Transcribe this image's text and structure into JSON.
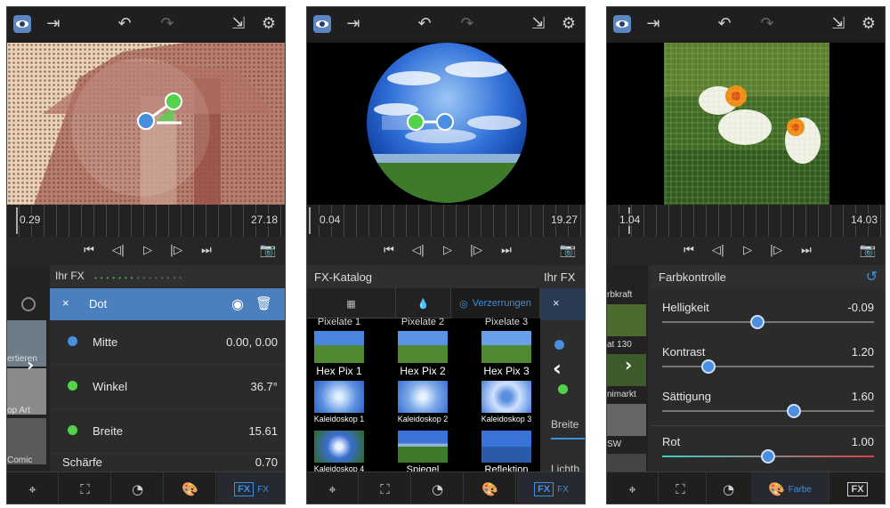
{
  "screens": [
    {
      "timeline": {
        "start": "0.29",
        "end": "27.18"
      },
      "panel_title": "Ihr FX",
      "side_labels": [
        "ertieren",
        "op Art",
        "Comic"
      ],
      "selected": {
        "close": "×",
        "name": "Dot"
      },
      "params": [
        {
          "name": "Mitte",
          "value": "0.00, 0.00"
        },
        {
          "name": "Winkel",
          "value": "36.7°"
        },
        {
          "name": "Breite",
          "value": "15.61"
        },
        {
          "name": "Schärfe",
          "value": "0.70"
        }
      ],
      "bottom_active_label": "FX"
    },
    {
      "timeline": {
        "start": "0.04",
        "end": "19.27"
      },
      "panel_title": "FX-Katalog",
      "overlay_title": "Ihr FX",
      "tab_active_label": "Verzerrungen",
      "grid_top": [
        "Pixelate 1",
        "Pixelate 2",
        "Pixelate 3"
      ],
      "grid": [
        [
          "Hex Pix 1",
          "Hex Pix 2",
          "Hex Pix 3"
        ],
        [
          "Kaleidoskop 1",
          "Kaleidoskop 2",
          "Kaleidoskop 3"
        ],
        [
          "Kaleidoskop 4",
          "Spiegel",
          "Reflektion"
        ]
      ],
      "overlay_labels": [
        "Breite",
        "Lichtb"
      ],
      "bottom_active_label": "FX"
    },
    {
      "timeline": {
        "start": "1.04",
        "end": "14.03"
      },
      "panel_title": "Farbkontrolle",
      "side_labels": [
        "rbkraft",
        "at 130",
        "nimarkt",
        "SW"
      ],
      "sliders": [
        {
          "name": "Helligkeit",
          "value": "-0.09",
          "level": 0.45
        },
        {
          "name": "Kontrast",
          "value": "1.20",
          "level": 0.22
        },
        {
          "name": "Sättigung",
          "value": "1.60",
          "level": 0.62
        },
        {
          "name": "Rot",
          "value": "1.00",
          "level": 0.5
        }
      ],
      "bottom_active_label": "Farbe"
    }
  ],
  "colors": {
    "accent": "#3d8fe0",
    "selected_row": "#4b7fbe",
    "handle_green": "#54d24a"
  }
}
